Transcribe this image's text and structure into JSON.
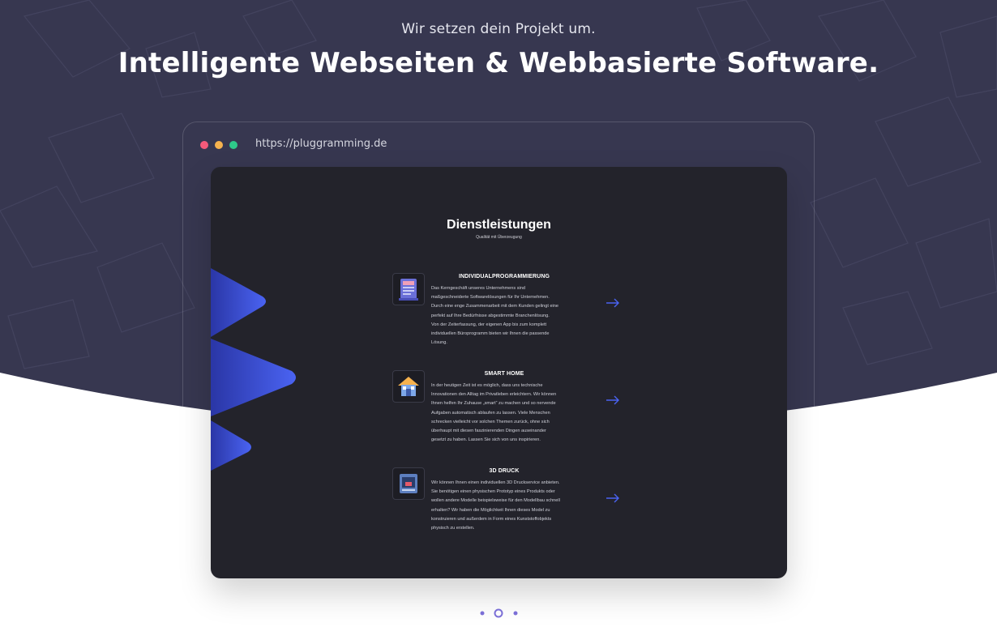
{
  "hero": {
    "kicker": "Wir setzen dein Projekt um.",
    "headline": "Intelligente Webseiten & Webbasierte Software.",
    "background_color": "#373750"
  },
  "browser": {
    "url": "https://pluggramming.de",
    "dots": [
      "#f45a7a",
      "#f6b24e",
      "#2ec98a"
    ]
  },
  "services": {
    "title": "Dienstleistungen",
    "subtitle": "Qualität mit Überzeugung",
    "accent": "#4a63f2",
    "items": [
      {
        "title": "INDIVIDUALPROGRAMMIERUNG",
        "icon": "code-document-icon",
        "lines": [
          "Das Kerngeschäft unseres Unternehmens sind",
          "maßgeschneiderte Softwarelösungen für Ihr Unternehmen.",
          "Durch eine enge Zusammenarbeit mit dem Kunden gelingt eine",
          "perfekt auf Ihre Bedürfnisse abgestimmte Branchenlösung.",
          "Von der Zeiterfassung, der eigenen App bis zum komplett",
          "individuellen Büroprogramm bieten wir Ihnen die passende",
          "Lösung."
        ]
      },
      {
        "title": "SMART HOME",
        "icon": "smart-home-icon",
        "lines": [
          "In der heutigen Zeit ist es möglich, dass uns technische",
          "Innovationen den Alltag im Privatleben erleichtern. Wir können",
          "Ihnen helfen Ihr Zuhause „smart“ zu machen und so nervende",
          "Aufgaben automatisch ablaufen zu lassen. Viele Menschen",
          "schrecken vielleicht vor solchen Themen zurück, ohne sich",
          "überhaupt mit diesen faszinierenden Dingen auseinander",
          "gesetzt zu haben. Lassen Sie sich von uns inspirieren."
        ]
      },
      {
        "title": "3D DRUCK",
        "icon": "3d-printer-icon",
        "lines": [
          "Wir können Ihnen einen individuellen 3D Druckservice anbieten.",
          "Sie benötigen einen physischen Prototyp eines Produkts oder",
          "wollen andere Modelle beispielsweise für den Modellbau schnell",
          "erhalten? Wir haben die Möglichkeit Ihnen dieses Model zu",
          "konstruieren und außerdem in Form eines Kunststoffobjekts",
          "physisch zu erstellen."
        ]
      }
    ]
  },
  "pager": {
    "count": 3,
    "active_index": 1,
    "color": "#7b6fd6"
  }
}
